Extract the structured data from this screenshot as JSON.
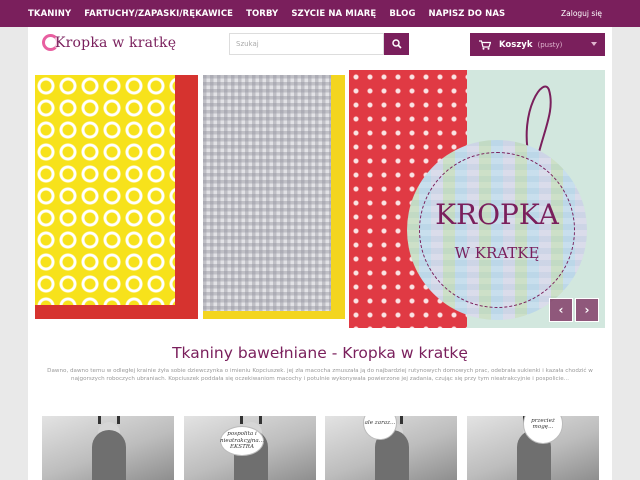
{
  "topnav": {
    "items": [
      "TKANINY",
      "FARTUCHY/ZAPASKI/RĘKAWICE",
      "TORBY",
      "SZYCIE NA MIARĘ",
      "BLOG",
      "NAPISZ DO NAS"
    ],
    "login": "Zaloguj się"
  },
  "header": {
    "logo_text": "Kropka w kratkę",
    "search_placeholder": "Szukaj",
    "cart_label": "Koszyk",
    "cart_status": "(pusty)"
  },
  "slider": {
    "tag_line1": "KROPKA",
    "tag_line2": "W KRATKĘ",
    "prev": "‹",
    "next": "›"
  },
  "content": {
    "title": "Tkaniny bawełniane - Kropka w kratkę",
    "description": "Dawno, dawno temu w odległej krainie żyła sobie dziewczynka o imieniu Kopciuszek. jej zła macocha zmuszała ją do najbardziej rutynowych domowych prac, odebrała sukienki i kazała chodzić w najgorszych roboczych ubraniach. Kopciuszek poddała się oczekiwaniom macochy i potulnie wykonywała powierzone jej zadania, czując się przy tym nieatrakcyjnie i pospolicie..."
  },
  "thumbs": {
    "bubbles": [
      "pospolita i nieatrakcyjna... EKSTRA",
      "ale zaraz...",
      "przecież mogę..."
    ]
  },
  "colors": {
    "brand": "#7a1f5c",
    "page_bg": "#e9e9e9"
  }
}
